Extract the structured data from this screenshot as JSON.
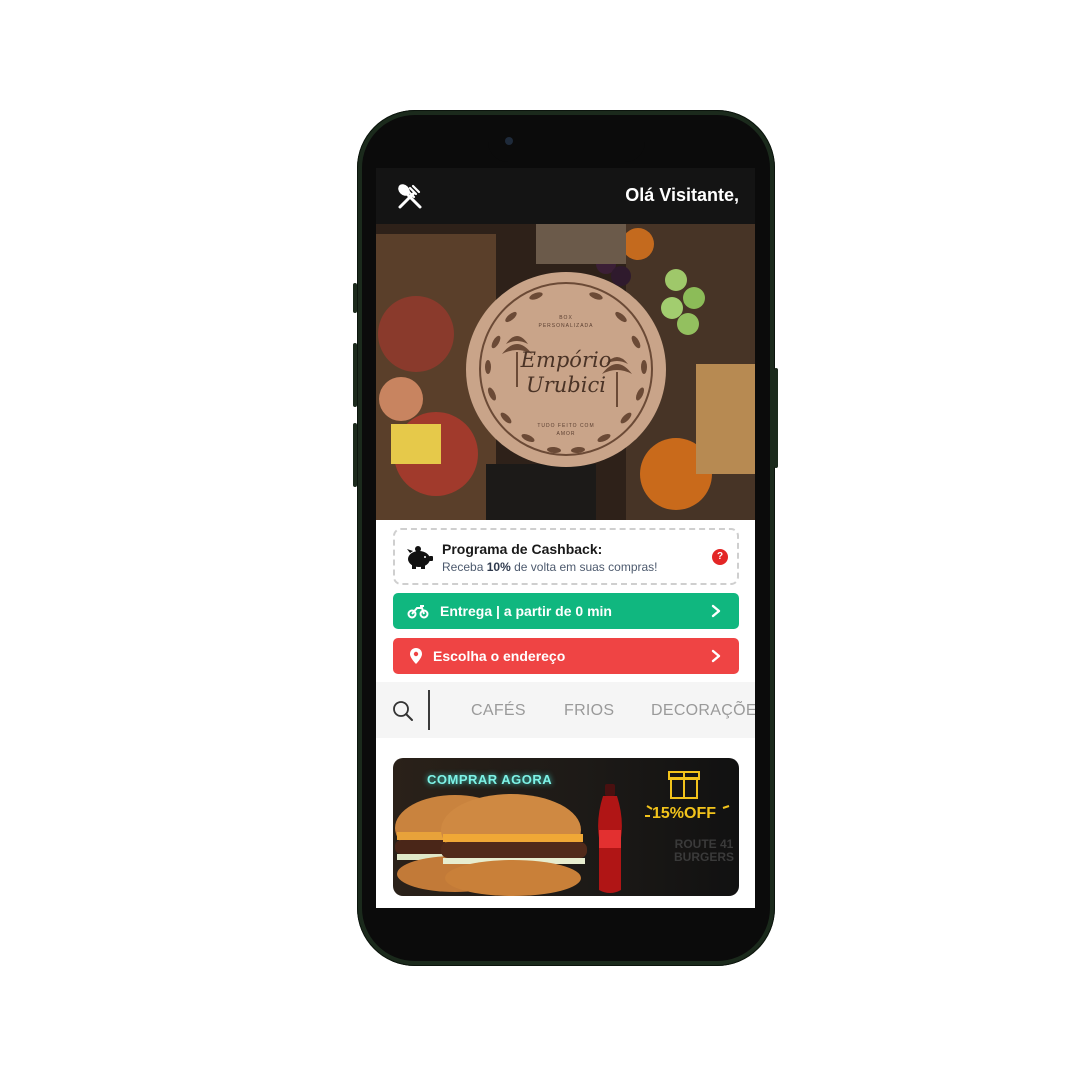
{
  "header": {
    "greeting": "Olá Visitante,",
    "menu_icon": "utensils-icon"
  },
  "hero": {
    "logo_top_text": "BOX PERSONALIZADA",
    "logo_name_line1": "Empório",
    "logo_name_line2": "Urubici",
    "logo_bottom_text": "TUDO FEITO COM AMOR"
  },
  "cashback": {
    "title": "Programa de Cashback:",
    "sub_prefix": "Receba",
    "sub_percent": "10%",
    "sub_suffix": "de volta em suas compras!",
    "help_label": "?",
    "icon": "piggy-bank-icon"
  },
  "delivery": {
    "label": "Entrega | a partir de 0 min",
    "color": "#10b77f",
    "icon": "motorcycle-icon"
  },
  "address": {
    "label": "Escolha o endereço",
    "color": "#ef4444",
    "icon": "map-pin-icon"
  },
  "categories": {
    "items": [
      "CAFÉS",
      "FRIOS",
      "DECORAÇÕES"
    ]
  },
  "banner": {
    "cta": "COMPRAR AGORA",
    "discount": "15%OFF",
    "brand_line1": "ROUTE 41",
    "brand_line2": "BURGERS"
  }
}
